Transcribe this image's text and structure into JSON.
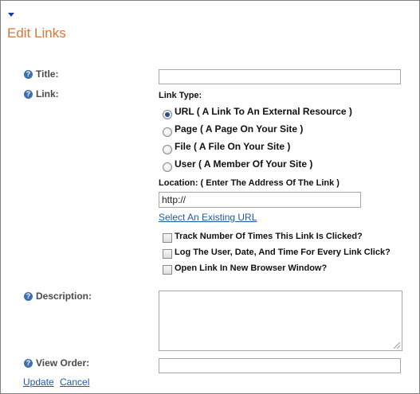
{
  "header": {
    "title": "Edit Links"
  },
  "help_glyph": "?",
  "form": {
    "title_label": "Title:",
    "title_value": "",
    "link_label": "Link:",
    "link_type_label": "Link Type:",
    "link_types": [
      {
        "label": "URL ( A Link To An External Resource )",
        "selected": true
      },
      {
        "label": "Page ( A Page On Your Site )",
        "selected": false
      },
      {
        "label": "File ( A File On Your Site )",
        "selected": false
      },
      {
        "label": "User ( A Member Of Your Site )",
        "selected": false
      }
    ],
    "location_label": "Location: ( Enter The Address Of The Link )",
    "location_value": "http://",
    "select_existing_link": "Select An Existing URL",
    "options": [
      {
        "label": "Track Number Of Times This Link Is Clicked?",
        "checked": false
      },
      {
        "label": "Log The User, Date, And Time For Every Link Click?",
        "checked": false
      },
      {
        "label": "Open Link In New Browser Window?",
        "checked": false
      }
    ],
    "description_label": "Description:",
    "description_value": "",
    "view_order_label": "View Order:",
    "view_order_value": ""
  },
  "actions": {
    "update": "Update",
    "cancel": "Cancel"
  },
  "colors": {
    "heading": "#d9763a",
    "link": "#1d5aa8",
    "help_icon": "#3e6fb1"
  }
}
